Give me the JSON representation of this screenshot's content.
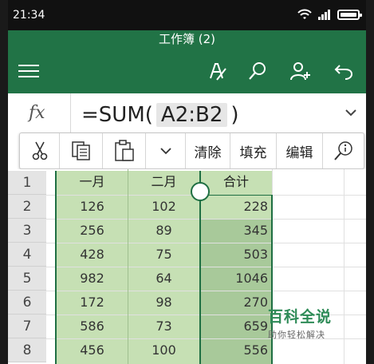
{
  "status_bar": {
    "time": "21:34"
  },
  "header": {
    "title": "工作簿 (2)"
  },
  "formula_bar": {
    "fx_label": "fx",
    "formula_prefix": "=SUM(",
    "formula_ref": "A2:B2",
    "formula_suffix": ")"
  },
  "context_menu": {
    "items": [
      {
        "label": "清除"
      },
      {
        "label": "填充"
      },
      {
        "label": "编辑"
      }
    ]
  },
  "sheet": {
    "row_numbers": [
      "1",
      "2",
      "3",
      "4",
      "5",
      "6",
      "7",
      "8"
    ],
    "headers": [
      "一月",
      "二月",
      "合计"
    ],
    "rows": [
      [
        "126",
        "102",
        "228"
      ],
      [
        "256",
        "89",
        "345"
      ],
      [
        "428",
        "75",
        "503"
      ],
      [
        "982",
        "64",
        "1046"
      ],
      [
        "172",
        "98",
        "270"
      ],
      [
        "586",
        "73",
        "659"
      ],
      [
        "456",
        "100",
        "556"
      ]
    ]
  },
  "watermark": {
    "title": "百科全说",
    "subtitle": "助你轻松解决"
  },
  "colors": {
    "accent": "#217346",
    "selection_fill": "#c6e0b4",
    "selection_dark": "#a8c99a",
    "selection_border": "#1f6f43"
  }
}
